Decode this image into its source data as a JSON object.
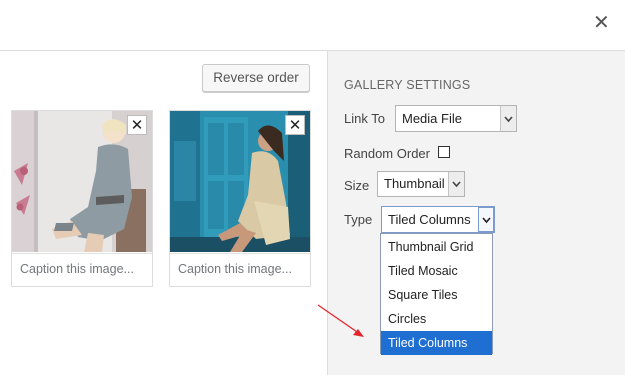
{
  "modal": {
    "close_icon": "close-icon"
  },
  "toolbar": {
    "reverse_label": "Reverse order"
  },
  "attachments": [
    {
      "caption_placeholder": "Caption this image...",
      "remove_icon": "remove-icon"
    },
    {
      "caption_placeholder": "Caption this image...",
      "remove_icon": "remove-icon"
    }
  ],
  "settings": {
    "title": "GALLERY SETTINGS",
    "link_to": {
      "label": "Link To",
      "value": "Media File"
    },
    "random_order": {
      "label": "Random Order",
      "checked": false
    },
    "size": {
      "label": "Size",
      "value": "Thumbnail"
    },
    "type": {
      "label": "Type",
      "value": "Tiled Columns",
      "options": [
        "Thumbnail Grid",
        "Tiled Mosaic",
        "Square Tiles",
        "Circles",
        "Tiled Columns"
      ],
      "highlighted": "Tiled Columns"
    }
  },
  "colors": {
    "sidebar_bg": "#f3f3f3",
    "highlight": "#1e6fd1",
    "annotation_arrow": "#e3262b"
  }
}
